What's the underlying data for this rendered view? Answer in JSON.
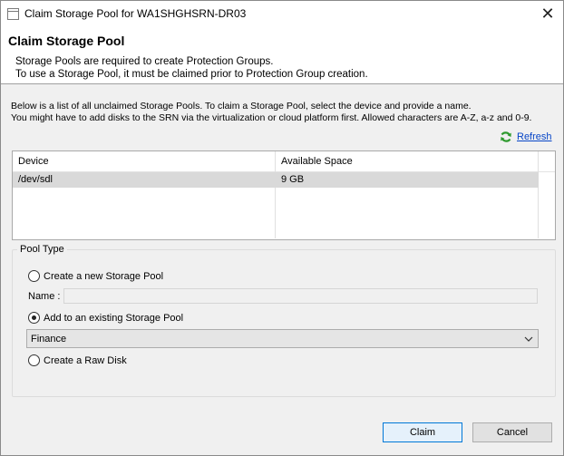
{
  "window": {
    "title": "Claim Storage Pool for WA1SHGHSRN-DR03",
    "close_glyph": "✕"
  },
  "header": {
    "title": "Claim Storage Pool",
    "desc_line1": "Storage Pools are required to create Protection Groups.",
    "desc_line2": "To use a Storage Pool, it must be claimed prior to Protection Group creation."
  },
  "info": {
    "line1": "Below is a list of all unclaimed Storage Pools. To claim a Storage Pool, select the device and provide a name.",
    "line2": "You might have to add disks to the SRN via the virtualization or cloud platform first. Allowed characters are A-Z, a-z and 0-9."
  },
  "refresh": {
    "label": "Refresh",
    "icon": "refresh-icon",
    "color": "#0645c7"
  },
  "table": {
    "columns": [
      "Device",
      "Available Space"
    ],
    "rows": [
      {
        "device": "/dev/sdl",
        "space": "9 GB",
        "selected": true
      }
    ]
  },
  "pool_type": {
    "group_label": "Pool Type",
    "option_new": "Create a new Storage Pool",
    "name_label": "Name :",
    "name_value": "",
    "option_existing": "Add to an existing Storage Pool",
    "selected_pool": "Finance",
    "option_raw": "Create a Raw Disk",
    "selected_option": "existing"
  },
  "buttons": {
    "claim": "Claim",
    "cancel": "Cancel"
  },
  "colors": {
    "accent": "#0078d7",
    "selected_row": "#d9d9d9",
    "dialog_bg": "#f0f0f0"
  }
}
